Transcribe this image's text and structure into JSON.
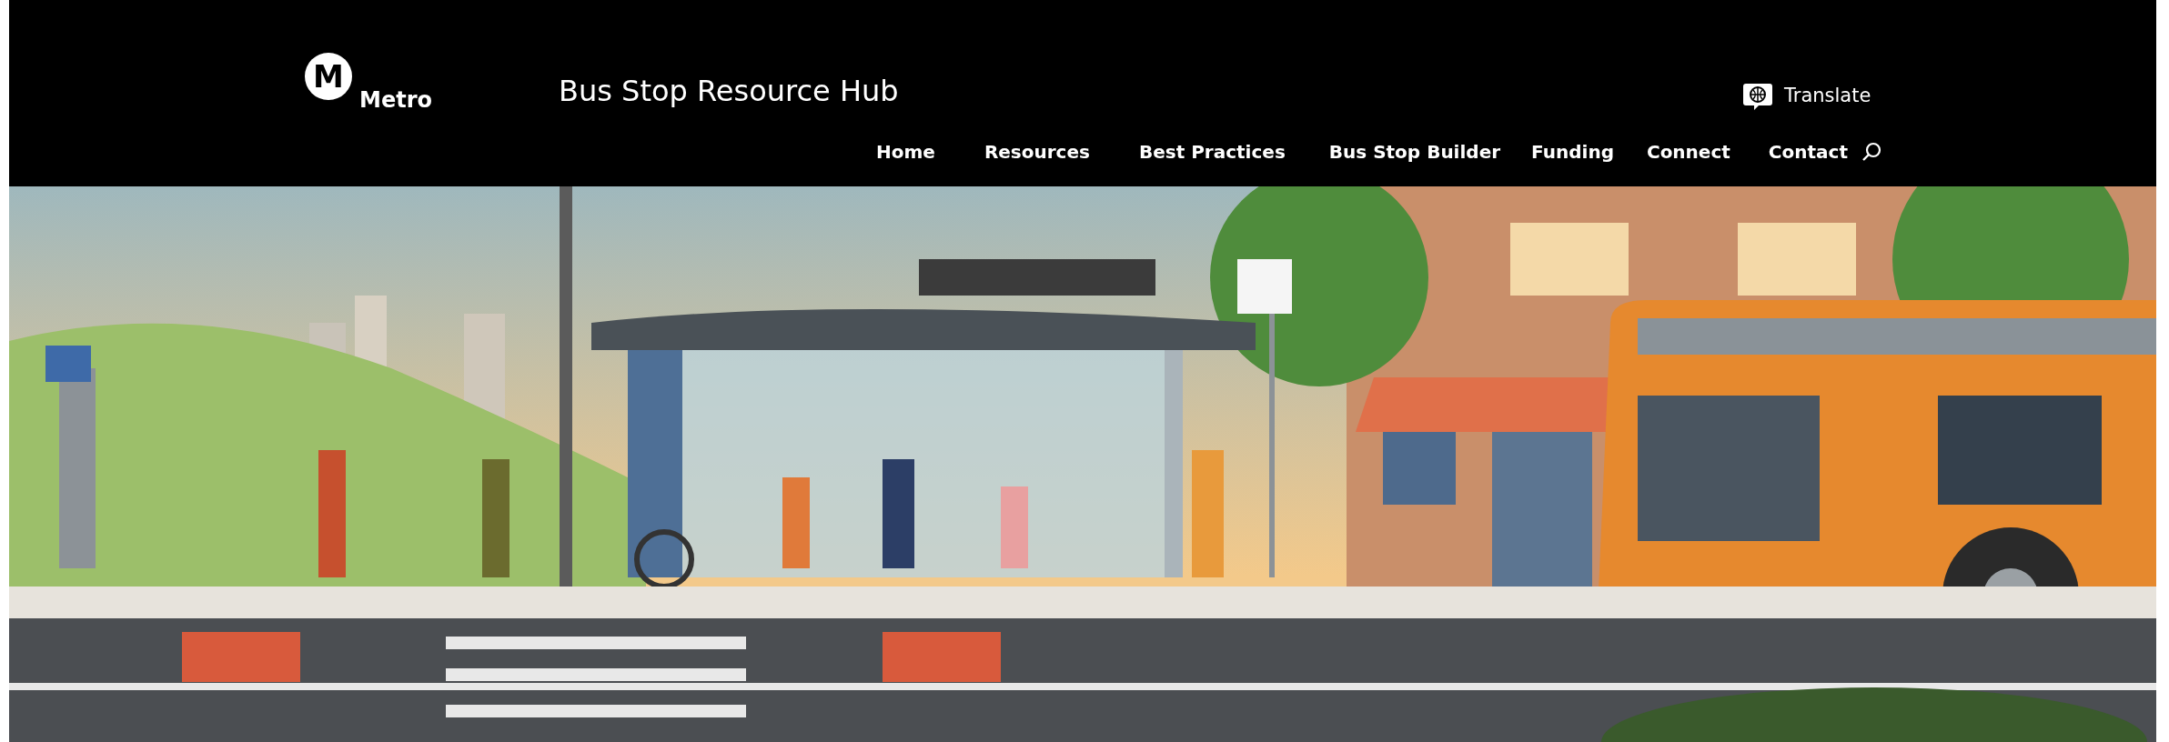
{
  "header": {
    "logo": {
      "letter": "M",
      "wordmark": "Metro"
    },
    "site_title": "Bus Stop Resource Hub",
    "translate": "Translate",
    "nav": [
      {
        "label": "Home"
      },
      {
        "label": "Resources"
      },
      {
        "label": "Best Practices"
      },
      {
        "label": "Bus Stop Builder"
      },
      {
        "label": "Funding"
      },
      {
        "label": "Connect"
      },
      {
        "label": "Contact"
      }
    ]
  }
}
